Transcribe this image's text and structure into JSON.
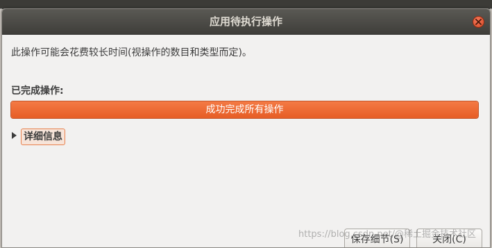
{
  "window": {
    "title": "应用待执行操作"
  },
  "message": "此操作可能会花费较长时间(视操作的数目和类型而定)。",
  "completed_label": "已完成操作:",
  "progress": {
    "text": "成功完成所有操作",
    "fraction": 1.0
  },
  "details": {
    "label": "详细信息",
    "expanded": false
  },
  "buttons": {
    "save": "保存细节(S)",
    "close": "关闭(C)"
  },
  "watermark": "https://blog.csdn.net/@稀土掘金技术社区",
  "colors": {
    "accent": "#e95420",
    "titlebar": "#3f3e3a",
    "close_button": "#df4a23"
  },
  "icons": {
    "close": "close-icon",
    "expander": "expander-arrow-icon"
  }
}
